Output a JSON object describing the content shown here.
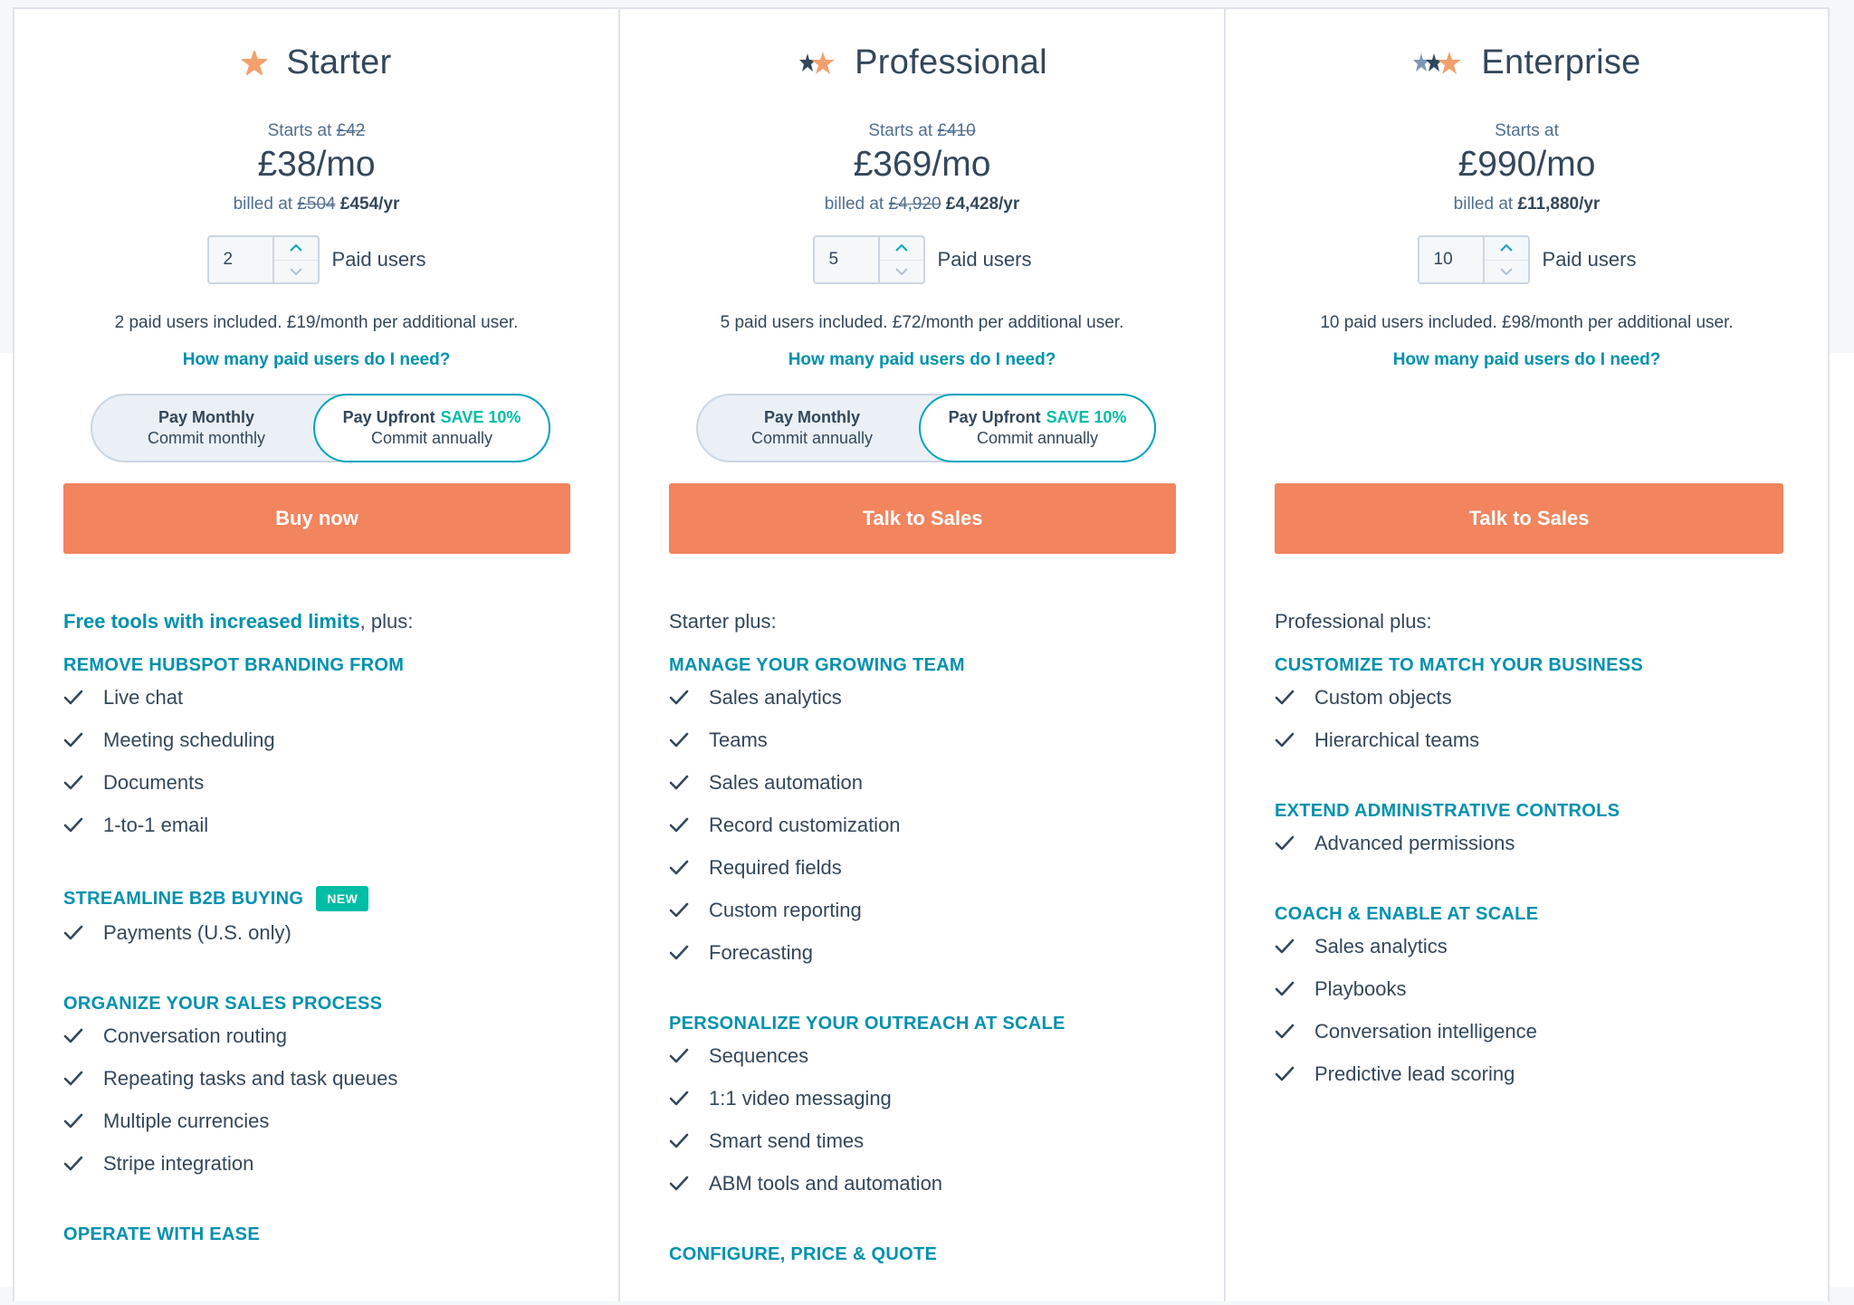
{
  "plans": [
    {
      "name": "Starter",
      "starts_label": "Starts at",
      "starts_strike": "£42",
      "price": "£38/mo",
      "billed_label": "billed at",
      "billed_strike": "£504",
      "billed_value": "£454/yr",
      "users_value": "2",
      "users_label": "Paid users",
      "included": "2 paid users included. £19/month per additional user.",
      "howmany": "How many paid users do I need?",
      "toggle": {
        "left_title": "Pay Monthly",
        "left_sub": "Commit monthly",
        "right_title": "Pay Upfront",
        "right_save": "SAVE 10%",
        "right_sub": "Commit annually"
      },
      "cta": "Buy now",
      "intro_link": "Free tools with increased limits",
      "intro_rest": ", plus:",
      "groups": [
        {
          "title": "Remove HubSpot branding from",
          "badge": "",
          "items": [
            "Live chat",
            "Meeting scheduling",
            "Documents",
            "1-to-1 email"
          ]
        },
        {
          "title": "Streamline B2B buying",
          "badge": "NEW",
          "items": [
            "Payments (U.S. only)"
          ]
        },
        {
          "title": "Organize your sales process",
          "badge": "",
          "items": [
            "Conversation routing",
            "Repeating tasks and task queues",
            "Multiple currencies",
            "Stripe integration"
          ]
        },
        {
          "title": "Operate with ease",
          "badge": "",
          "items": []
        }
      ]
    },
    {
      "name": "Professional",
      "starts_label": "Starts at",
      "starts_strike": "£410",
      "price": "£369/mo",
      "billed_label": "billed at",
      "billed_strike": "£4,920",
      "billed_value": "£4,428/yr",
      "users_value": "5",
      "users_label": "Paid users",
      "included": "5 paid users included. £72/month per additional user.",
      "howmany": "How many paid users do I need?",
      "toggle": {
        "left_title": "Pay Monthly",
        "left_sub": "Commit annually",
        "right_title": "Pay Upfront",
        "right_save": "SAVE 10%",
        "right_sub": "Commit annually"
      },
      "cta": "Talk to Sales",
      "intro_link": "",
      "intro_rest": "Starter plus:",
      "groups": [
        {
          "title": "Manage your growing team",
          "badge": "",
          "items": [
            "Sales analytics",
            "Teams",
            "Sales automation",
            "Record customization",
            "Required fields",
            "Custom reporting",
            "Forecasting"
          ]
        },
        {
          "title": "Personalize your outreach at scale",
          "badge": "",
          "items": [
            "Sequences",
            "1:1 video messaging",
            "Smart send times",
            "ABM tools and automation"
          ]
        },
        {
          "title": "Configure, price & quote",
          "badge": "",
          "items": []
        }
      ]
    },
    {
      "name": "Enterprise",
      "starts_label": "Starts at",
      "starts_strike": "",
      "price": "£990/mo",
      "billed_label": "billed at",
      "billed_strike": "",
      "billed_value": "£11,880/yr",
      "users_value": "10",
      "users_label": "Paid users",
      "included": "10 paid users included. £98/month per additional user.",
      "howmany": "How many paid users do I need?",
      "cta": "Talk to Sales",
      "intro_link": "",
      "intro_rest": "Professional plus:",
      "groups": [
        {
          "title": "Customize to match your business",
          "badge": "",
          "items": [
            "Custom objects",
            "Hierarchical teams"
          ]
        },
        {
          "title": "Extend administrative controls",
          "badge": "",
          "items": [
            "Advanced permissions"
          ]
        },
        {
          "title": "Coach & enable at scale",
          "badge": "",
          "items": [
            "Sales analytics",
            "Playbooks",
            "Conversation intelligence",
            "Predictive lead scoring"
          ]
        }
      ]
    }
  ],
  "colors": {
    "accent": "#f2845e",
    "link": "#0091ae",
    "save": "#00bda5",
    "text": "#33475b"
  },
  "icons": [
    "sprocket-star-icon",
    "chevron-up-icon",
    "chevron-down-icon",
    "check-icon"
  ]
}
